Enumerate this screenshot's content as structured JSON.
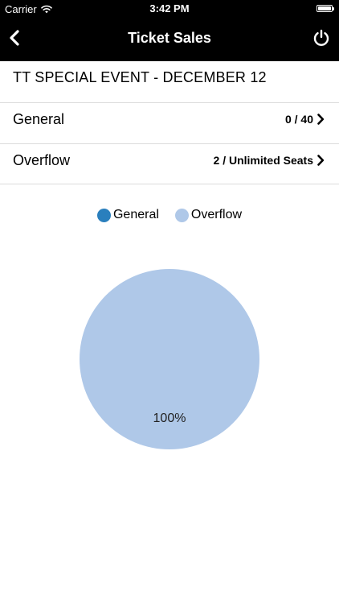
{
  "status_bar": {
    "carrier": "Carrier",
    "time": "3:42 PM",
    "wifi_icon": "wifi-icon",
    "battery_icon": "battery-icon"
  },
  "nav": {
    "title": "Ticket Sales",
    "back_icon": "chevron-left-icon",
    "power_icon": "power-icon"
  },
  "event": {
    "title": "TT SPECIAL EVENT - DECEMBER 12"
  },
  "rows": [
    {
      "label": "General",
      "value": "0 / 40"
    },
    {
      "label": "Overflow",
      "value": "2 / Unlimited Seats"
    }
  ],
  "colors": {
    "general": "#2a7fbd",
    "overflow": "#afc8e8"
  },
  "chart_data": {
    "type": "pie",
    "categories": [
      "General",
      "Overflow"
    ],
    "values": [
      0,
      2
    ],
    "slice_labels": [
      "",
      "100%"
    ],
    "legend": [
      "General",
      "Overflow"
    ],
    "legend_position": "top"
  }
}
